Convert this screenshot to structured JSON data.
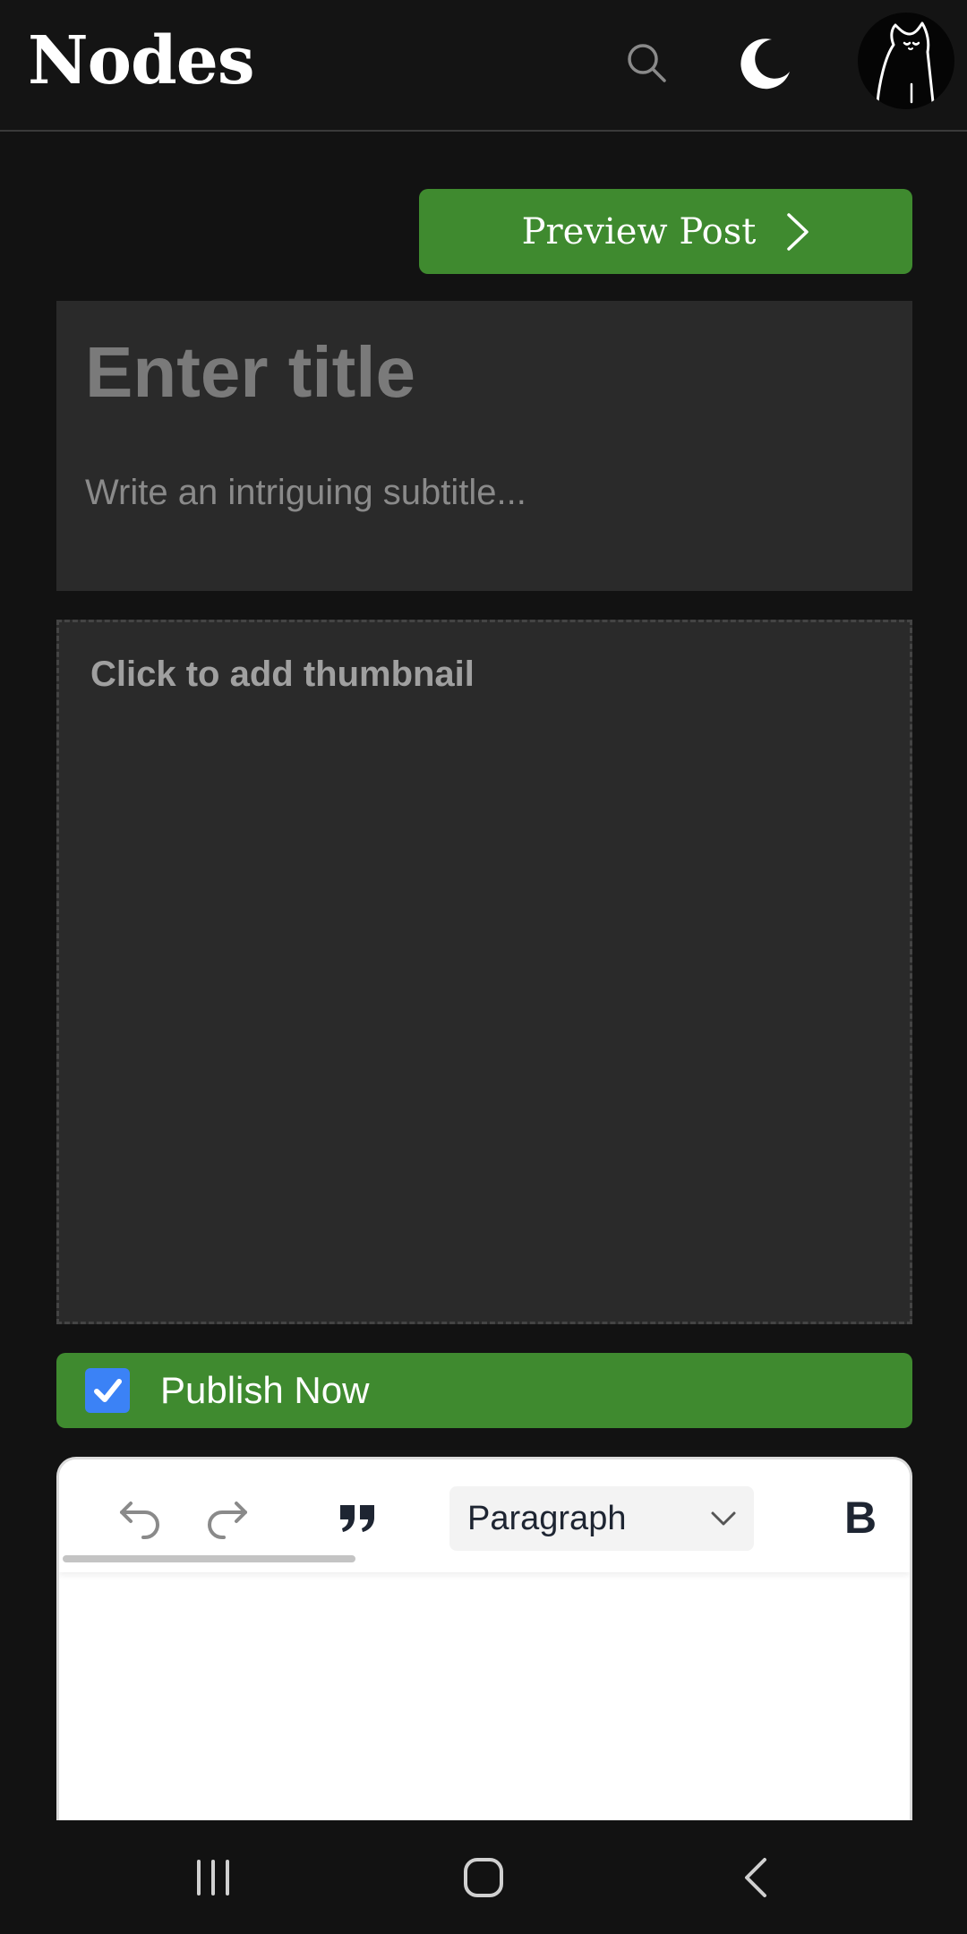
{
  "header": {
    "brand": "Nodes",
    "search_icon": "search-icon",
    "theme_icon": "moon-icon",
    "avatar_icon": "cat-avatar"
  },
  "editor_page": {
    "preview_button": {
      "label": "Preview Post",
      "icon": "chevron-right-icon"
    },
    "title_placeholder": "Enter title",
    "subtitle_placeholder": "Write an intriguing subtitle...",
    "thumbnail_label": "Click to add thumbnail",
    "publish": {
      "label": "Publish Now",
      "checked": true
    }
  },
  "toolbar": {
    "undo_icon": "undo-icon",
    "redo_icon": "redo-icon",
    "quote_icon": "quote-icon",
    "block_type": "Paragraph",
    "bold_label": "B"
  },
  "navbar": {
    "recent_icon": "recent-apps-icon",
    "home_icon": "home-icon",
    "back_icon": "back-icon"
  },
  "colors": {
    "background": "#121212",
    "accent_green": "#3f8a2f",
    "panel": "#2a2a2a",
    "checkbox_blue": "#3b82f6"
  }
}
